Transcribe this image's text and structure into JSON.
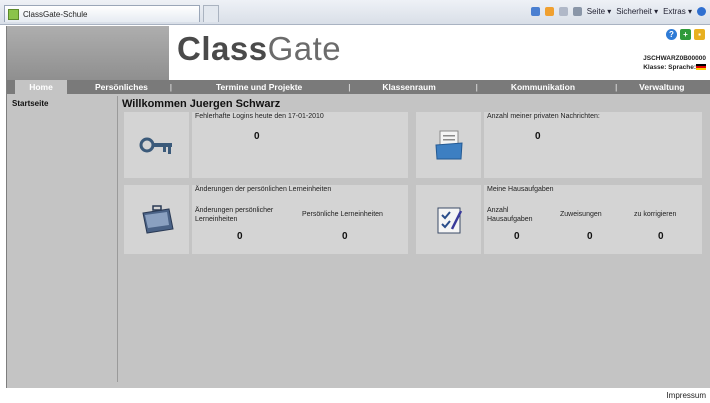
{
  "browser": {
    "tab_title": "ClassGate-Schule",
    "commands": [
      "Seite ▾",
      "Sicherheit ▾",
      "Extras ▾"
    ]
  },
  "header": {
    "logo_bold": "Class",
    "logo_light": "Gate",
    "user_id": "JSCHWARZ0B00000",
    "class_label": "Klasse:",
    "language_label": "Sprache:"
  },
  "nav": {
    "items": [
      "Home",
      "Persönliches",
      "Termine und Projekte",
      "Klassenraum",
      "Kommunikation",
      "Verwaltung"
    ],
    "separator": "|"
  },
  "sidebar": {
    "items": [
      "Startseite"
    ]
  },
  "main": {
    "welcome": "Willkommen Juergen Schwarz",
    "cards": [
      {
        "title": "Fehlerhafte Logins heute den 17-01-2010",
        "value": "0"
      },
      {
        "title": "Anzahl meiner privaten Nachrichten:",
        "value": "0"
      },
      {
        "title": "Änderungen der persönlichen Lerneinheiten",
        "col1_label": "Änderungen persönlicher Lerneinheiten",
        "col1_value": "0",
        "col2_label": "Persönliche Lerneinheiten",
        "col2_value": "0"
      },
      {
        "title": "Meine Hausaufgaben",
        "col1_label": "Anzahl Hausaufgaben",
        "col1_value": "0",
        "col2_label": "Zuweisungen",
        "col2_value": "0",
        "col3_label": "zu korrigieren",
        "col3_value": "0"
      }
    ]
  },
  "footer": {
    "impressum": "Impressum"
  }
}
